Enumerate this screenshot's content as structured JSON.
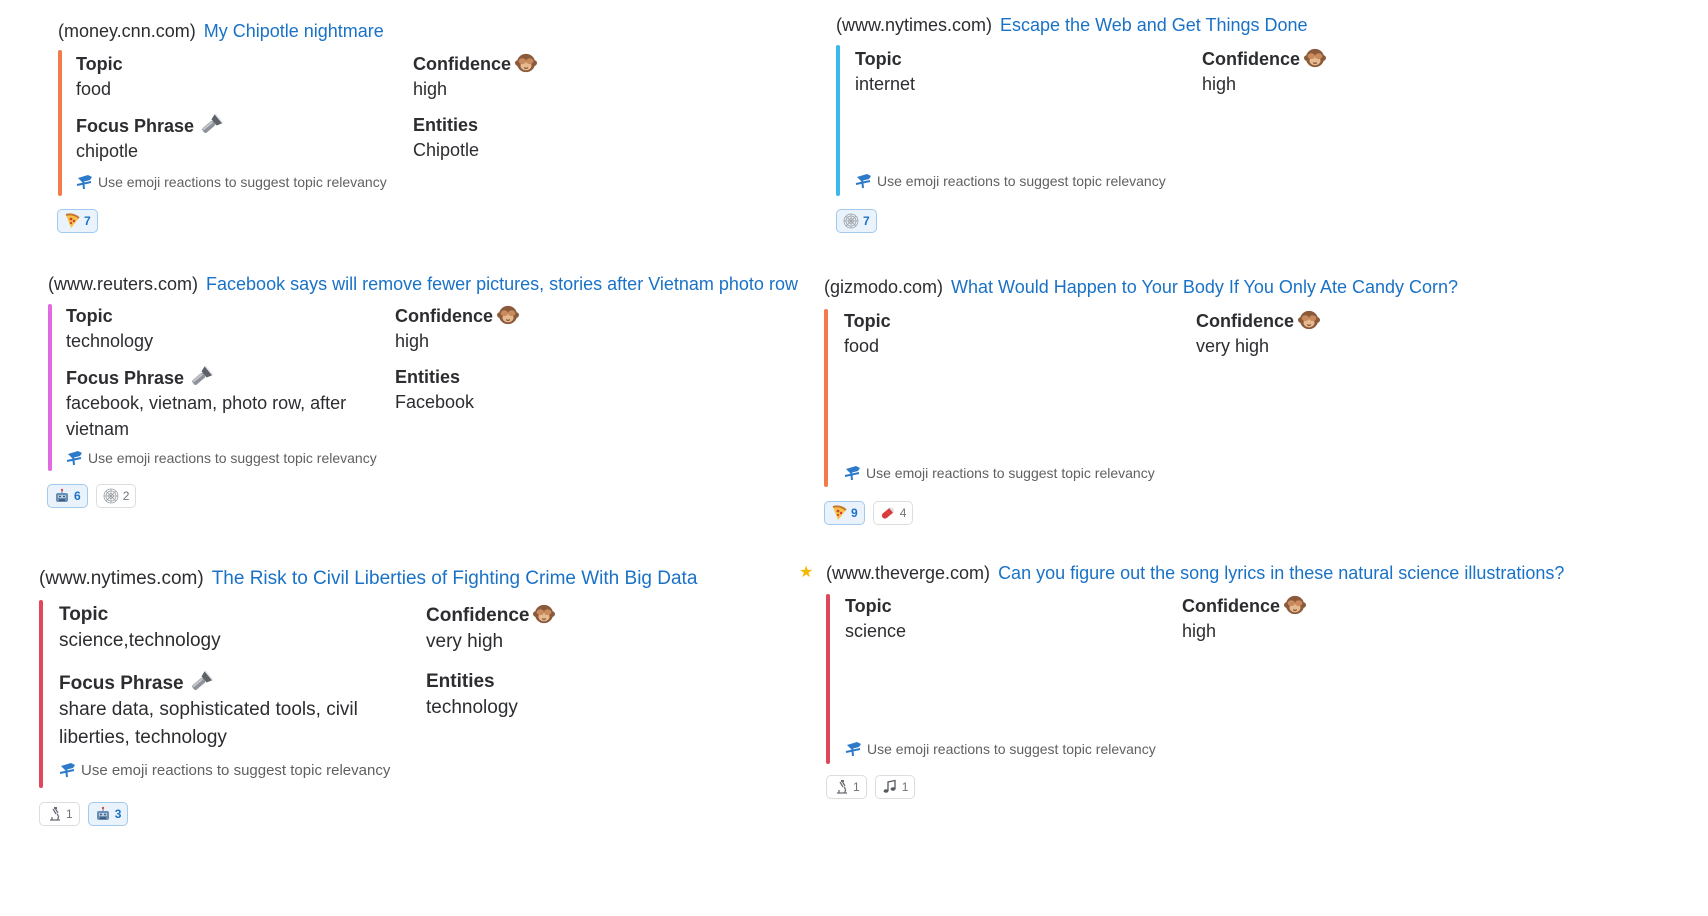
{
  "hint_text": "Use emoji reactions to suggest topic relevancy",
  "labels": {
    "topic": "Topic",
    "confidence": "Confidence",
    "focus_phrase": "Focus Phrase",
    "entities": "Entities"
  },
  "cards": [
    {
      "domain": "(money.cnn.com)",
      "title": "My Chipotle nightmare",
      "topic": "food",
      "confidence": "high",
      "focus_phrase": "chipotle",
      "entities": "Chipotle",
      "bar_color": "#f37b4a",
      "reactions": [
        {
          "icon": "pizza-icon",
          "count": "7",
          "active": true
        }
      ]
    },
    {
      "domain": "(www.nytimes.com)",
      "title": "Escape the Web and Get Things Done",
      "topic": "internet",
      "confidence": "high",
      "bar_color": "#3cb9ea",
      "reactions": [
        {
          "icon": "spider-web-icon",
          "count": "7",
          "active": true
        }
      ]
    },
    {
      "domain": "(www.reuters.com)",
      "title": "Facebook says will remove fewer pictures, stories after Vietnam photo row",
      "topic": "technology",
      "confidence": "high",
      "focus_phrase": "facebook, vietnam, photo row, after vietnam",
      "entities": "Facebook",
      "bar_color": "#e06ae0",
      "reactions": [
        {
          "icon": "robot-icon",
          "count": "6",
          "active": true
        },
        {
          "icon": "spider-web-icon",
          "count": "2",
          "active": false
        }
      ]
    },
    {
      "domain": "(gizmodo.com)",
      "title": "What Would Happen to Your Body If You Only Ate Candy Corn?",
      "topic": "food",
      "confidence": "very high",
      "bar_color": "#f37b4a",
      "reactions": [
        {
          "icon": "pizza-icon",
          "count": "9",
          "active": true
        },
        {
          "icon": "pill-icon",
          "count": "4",
          "active": false
        }
      ]
    },
    {
      "domain": "(www.nytimes.com)",
      "title": "The Risk to Civil Liberties of Fighting Crime With Big Data",
      "topic": "science,technology",
      "confidence": "very high",
      "focus_phrase": "share data, sophisticated tools, civil liberties, technology",
      "entities": "technology",
      "bar_color": "#e0475a",
      "reactions": [
        {
          "icon": "microscope-icon",
          "count": "1",
          "active": false
        },
        {
          "icon": "robot-icon",
          "count": "3",
          "active": true
        }
      ]
    },
    {
      "domain": "(www.theverge.com)",
      "title": "Can you figure out the song lyrics in these natural science illustrations?",
      "topic": "science",
      "confidence": "high",
      "bar_color": "#e0475a",
      "starred": true,
      "reactions": [
        {
          "icon": "microscope-icon",
          "count": "1",
          "active": false
        },
        {
          "icon": "music-notes-icon",
          "count": "1",
          "active": false
        }
      ]
    }
  ]
}
